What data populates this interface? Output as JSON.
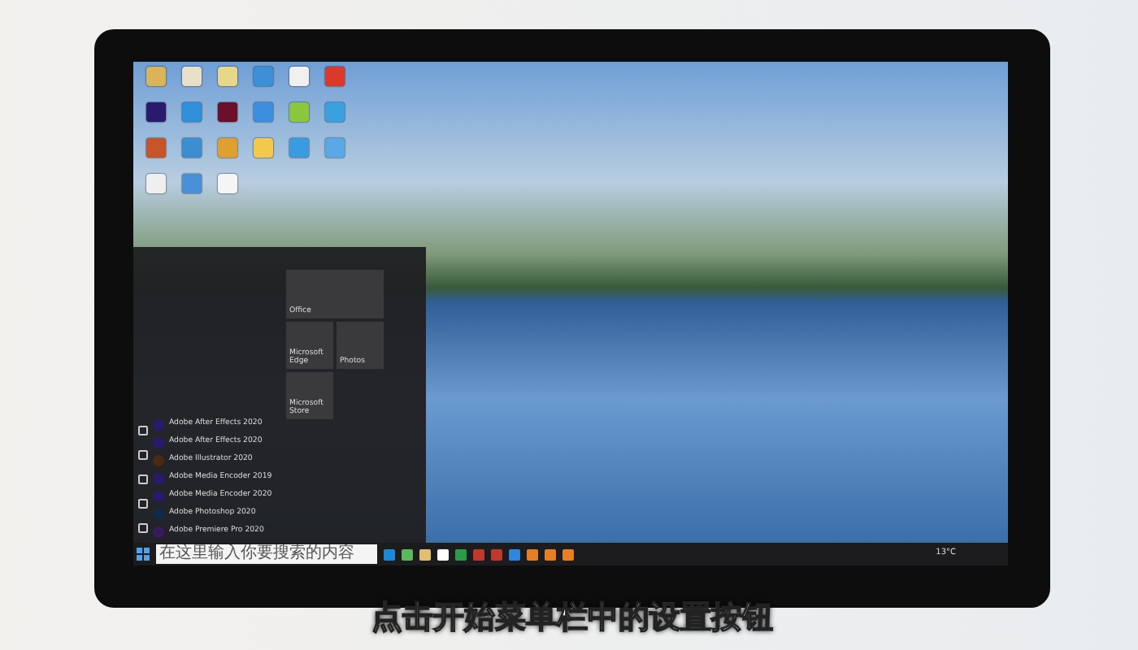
{
  "desktop_icons": [
    {
      "color": "#d9b45a"
    },
    {
      "color": "#e8e0c8"
    },
    {
      "color": "#e8d68a"
    },
    {
      "color": "#3d8fd6"
    },
    {
      "color": "#f0f0f0"
    },
    {
      "color": "#d93a2b"
    },
    {
      "color": "#2a1a6e"
    },
    {
      "color": "#2f8fd8"
    },
    {
      "color": "#6b0f2a"
    },
    {
      "color": "#3c8ee0"
    },
    {
      "color": "#8cc63f"
    },
    {
      "color": "#3aa0e0"
    },
    {
      "color": "#c8552a"
    },
    {
      "color": "#3b8fd0"
    },
    {
      "color": "#e0a030"
    },
    {
      "color": "#f2c94c"
    },
    {
      "color": "#3b9be0"
    },
    {
      "color": "#5aa8e6"
    },
    {
      "color": "#efefef"
    },
    {
      "color": "#4a90d9"
    },
    {
      "color": "#f5f5f5"
    }
  ],
  "start_menu": {
    "apps": [
      {
        "label": "Adobe After Effects 2020",
        "color": "#2a1a6e"
      },
      {
        "label": "Adobe After Effects 2020",
        "color": "#2a1a6e"
      },
      {
        "label": "Adobe Illustrator 2020",
        "color": "#4a2a10"
      },
      {
        "label": "Adobe Media Encoder 2019",
        "color": "#2a1a6e"
      },
      {
        "label": "Adobe Media Encoder 2020",
        "color": "#2a1a6e"
      },
      {
        "label": "Adobe Photoshop 2020",
        "color": "#0f2a4a"
      },
      {
        "label": "Adobe Premiere Pro 2020",
        "color": "#3a1a5e"
      }
    ],
    "tiles": [
      {
        "label": "Office",
        "kind": "large"
      },
      {
        "label": "Microsoft Edge",
        "kind": "medium"
      },
      {
        "label": "Photos",
        "kind": "medium"
      },
      {
        "label": "Microsoft Store",
        "kind": "medium"
      }
    ]
  },
  "taskbar": {
    "search": {
      "placeholder": "在这里输入你要搜索的内容"
    },
    "apps": [
      {
        "color": "#1e88d8"
      },
      {
        "color": "#5cb85c"
      },
      {
        "color": "#e0c070"
      },
      {
        "color": "#ffffff"
      },
      {
        "color": "#2a9d4a"
      },
      {
        "color": "#c0392b"
      },
      {
        "color": "#c0392b"
      },
      {
        "color": "#2e86de"
      },
      {
        "color": "#e67e22"
      },
      {
        "color": "#e67e22"
      },
      {
        "color": "#e67e22"
      }
    ],
    "weather": "13°C"
  },
  "subtitle": "点击开始菜单栏中的设置按钮"
}
